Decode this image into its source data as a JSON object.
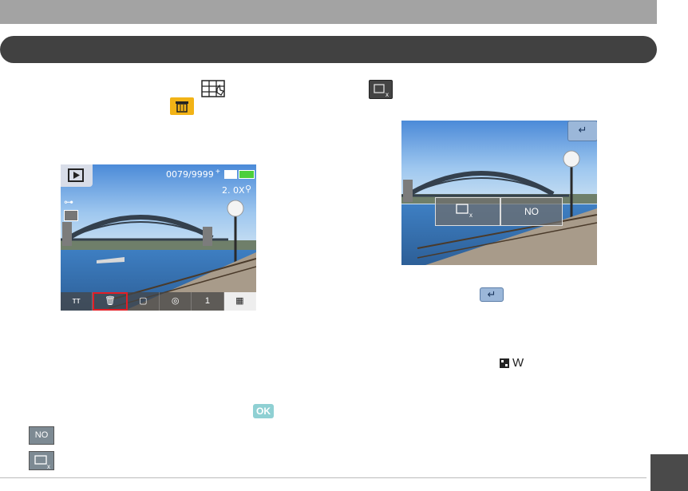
{
  "left_screen": {
    "counter": "0079/9999",
    "zoom": "2. 0X",
    "toolbar_items": [
      "🔧",
      "🗑",
      "▢",
      "◎",
      "1",
      "▦"
    ],
    "selected_toolbar_index": 1
  },
  "right_screen": {
    "delete_button_label": "",
    "no_button_label": "NO"
  },
  "inline_icons": {
    "ok_label": "OK",
    "size_w_label": "W",
    "no_label": "NO"
  },
  "colors": {
    "header_band": "#a3a3a3",
    "section_bar": "#414141",
    "delete_icon_bg": "#f2b316",
    "ok_icon_bg": "#8fd0d3",
    "selection_red": "#e21e26"
  }
}
